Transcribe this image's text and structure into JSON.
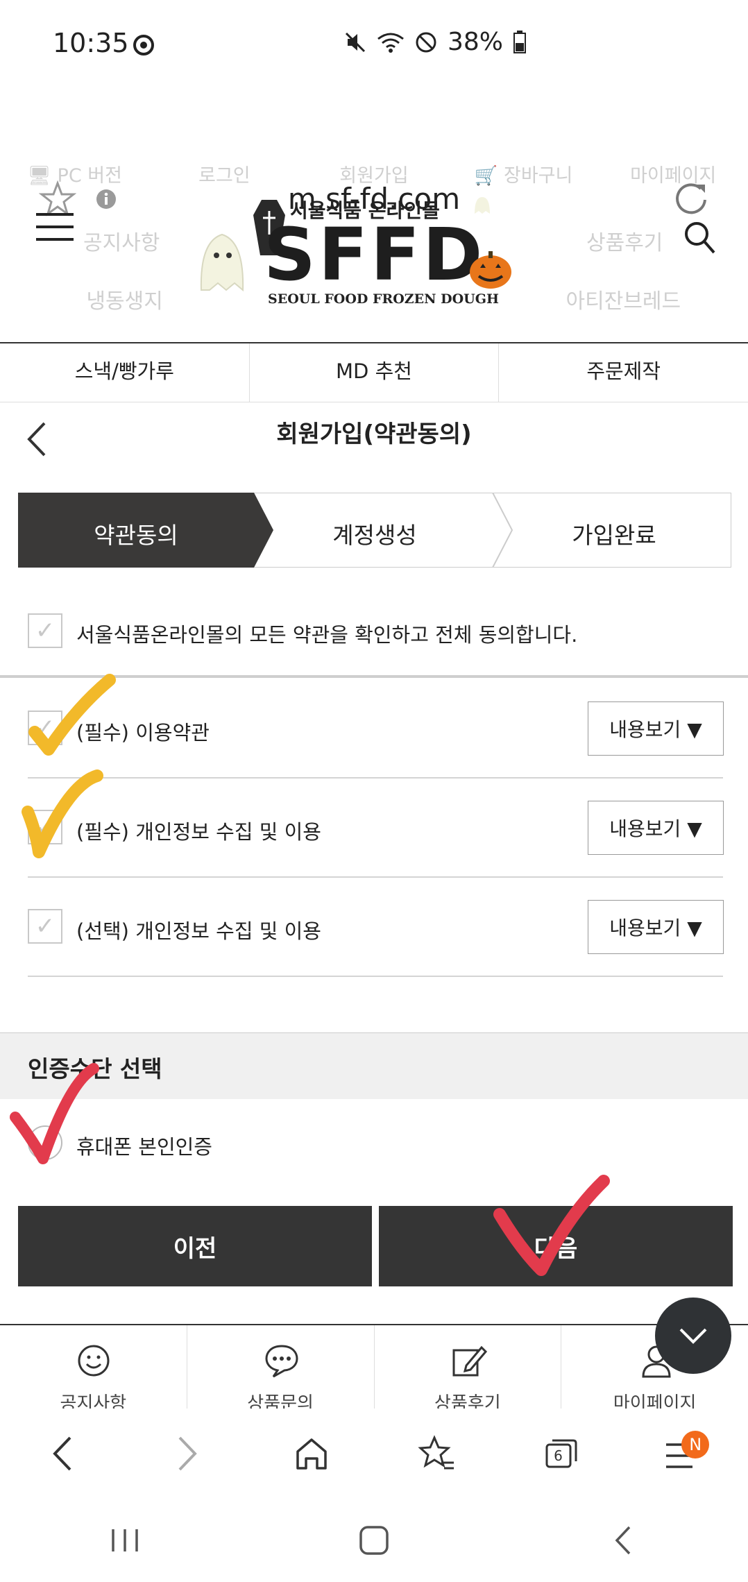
{
  "status_bar": {
    "time": "10:35",
    "battery": "38%"
  },
  "browser": {
    "url": "m.sf-fd.com",
    "tab_count": "6",
    "menu_badge": "N"
  },
  "site": {
    "top_menu": [
      "PC 버전",
      "로그인",
      "회원가입",
      "장바구니",
      "마이페이지"
    ],
    "header_left": "공지사항",
    "header_right": "상품후기",
    "logo": {
      "korean": "서울식품 온라인몰",
      "main": "SFFD",
      "sub": "SEOUL FOOD FROZEN DOUGH"
    },
    "faded_categories": [
      "냉동생지",
      "",
      "아티잔브레드"
    ],
    "categories": [
      "스낵/빵가루",
      "MD 추천",
      "주문제작"
    ]
  },
  "page": {
    "title": "회원가입(약관동의)",
    "steps": [
      "약관동의",
      "계정생성",
      "가입완료"
    ],
    "agree_all": "서울식품온라인몰의 모든 약관을 확인하고 전체 동의합니다.",
    "terms": [
      {
        "label": "(필수) 이용약관",
        "button": "내용보기 ▼"
      },
      {
        "label": "(필수) 개인정보 수집 및 이용",
        "button": "내용보기 ▼"
      },
      {
        "label": "(선택) 개인정보 수집 및 이용",
        "button": "내용보기 ▼"
      }
    ],
    "auth_title": "인증수단 선택",
    "auth_option": "휴대폰 본인인증",
    "prev_button": "이전",
    "next_button": "다음"
  },
  "site_nav": [
    "공지사항",
    "상품문의",
    "상품후기",
    "마이페이지"
  ],
  "colors": {
    "dark": "#353535",
    "yellow_mark": "#f2b92a",
    "red_mark": "#e23b4c",
    "badge": "#f26a1b"
  }
}
